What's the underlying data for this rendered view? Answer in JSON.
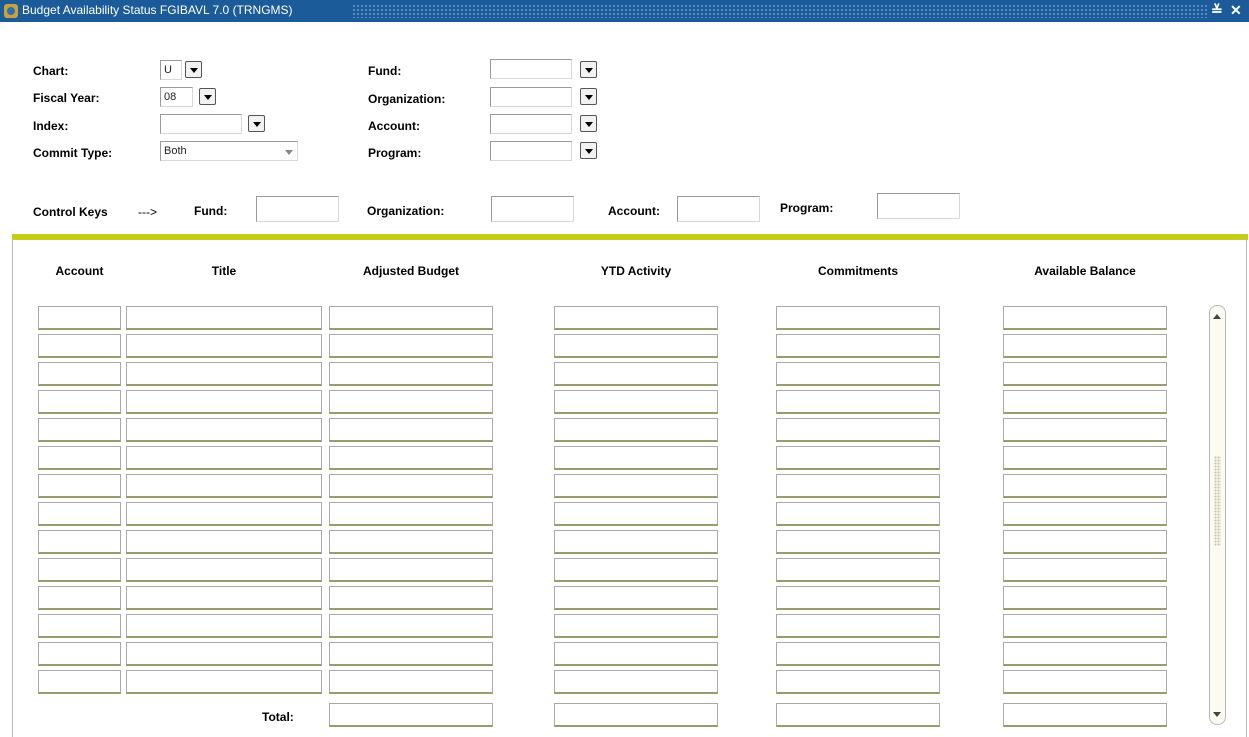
{
  "window": {
    "title": "Budget Availability Status  FGIBAVL  7.0  (TRNGMS)",
    "minimize_glyph": "≚",
    "close_glyph": "✕"
  },
  "key_block": {
    "chart_label": "Chart:",
    "chart_value": "U",
    "fiscal_year_label": "Fiscal Year:",
    "fiscal_year_value": "08",
    "index_label": "Index:",
    "index_value": "",
    "commit_type_label": "Commit Type:",
    "commit_type_value": "Both",
    "fund_label": "Fund:",
    "fund_value": "",
    "organization_label": "Organization:",
    "organization_value": "",
    "account_label": "Account:",
    "account_value": "",
    "program_label": "Program:",
    "program_value": ""
  },
  "control_keys": {
    "label": "Control Keys",
    "arrow": "--->",
    "fund_label": "Fund:",
    "organization_label": "Organization:",
    "account_label": "Account:",
    "program_label": "Program:"
  },
  "table": {
    "columns": [
      "Account",
      "Title",
      "Adjusted Budget",
      "YTD Activity",
      "Commitments",
      "Available Balance"
    ],
    "row_count": 14,
    "total_label": "Total:"
  },
  "icons": {
    "app": "banner-app-icon",
    "dropdown": "chevron-down-icon",
    "scroll_up": "scroll-up-icon",
    "scroll_down": "scroll-down-icon"
  },
  "colors": {
    "titlebar": "#1c5b9a",
    "divider": "#c8cc1a"
  }
}
